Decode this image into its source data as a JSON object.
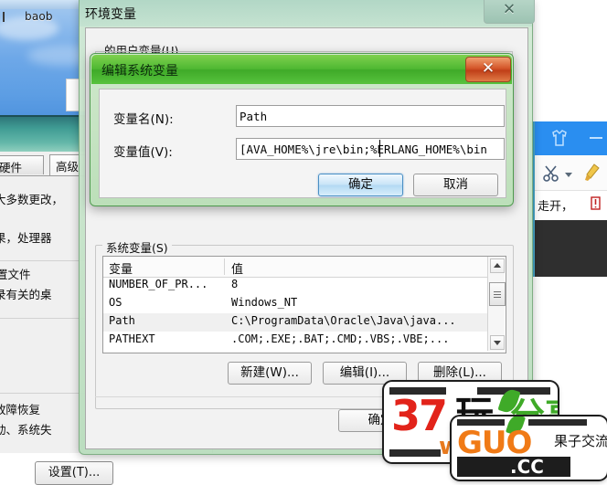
{
  "desktop": {
    "taskbar_label": "baob",
    "logo_icon": "windows-logo-icon"
  },
  "system_properties": {
    "tabs": [
      {
        "label": "硬件"
      },
      {
        "label": "高级"
      }
    ],
    "lines": [
      "大多数更改，",
      "果，处理器",
      "置文件",
      "录有关的桌",
      "故障恢复",
      "动、系统失"
    ],
    "settings_button": "设置(T)..."
  },
  "blue_app": {
    "shirt_icon": "shirt-icon",
    "minimize_icon": "minimize-icon",
    "cut_icon": "scissors-icon",
    "dropdown_icon": "chevron-down-icon",
    "brush_icon": "brush-icon",
    "alert_icon": "alert-icon",
    "text": "走开，"
  },
  "env_window": {
    "title": "环境变量",
    "close_icon": "close-icon",
    "user_vars_label": "的用户变量(U)",
    "ok_button": "确定"
  },
  "edit_dialog": {
    "title": "编辑系统变量",
    "close_icon": "close-icon",
    "name_label": "变量名(N):",
    "name_value": "Path",
    "value_label": "变量值(V):",
    "value_value": "[AVA_HOME%\\jre\\bin;%ERLANG_HOME%\\bin",
    "ok_button": "确定",
    "cancel_button": "取消"
  },
  "system_vars": {
    "group_label": "系统变量(S)",
    "columns": [
      "变量",
      "值"
    ],
    "rows": [
      {
        "name": "NUMBER_OF_PR...",
        "value": "8",
        "selected": false
      },
      {
        "name": "OS",
        "value": "Windows_NT",
        "selected": false
      },
      {
        "name": "Path",
        "value": "C:\\ProgramData\\Oracle\\Java\\java...",
        "selected": true
      },
      {
        "name": "PATHEXT",
        "value": ".COM;.EXE;.BAT;.CMD;.VBS;.VBE;...",
        "selected": false
      }
    ],
    "scrollbar": {
      "up_icon": "scroll-up-arrow-icon",
      "down_icon": "scroll-down-arrow-icon"
    },
    "new_button": "新建(W)...",
    "edit_button": "编辑(I)...",
    "delete_button": "删除(L)..."
  },
  "watermarks": {
    "wm37": {
      "number": "37",
      "char": "玩",
      "green_text": "分享社区",
      "www": "www"
    },
    "wmguo": {
      "brand": "GUO",
      "tld": ".CC",
      "sub": "果子交流"
    }
  }
}
